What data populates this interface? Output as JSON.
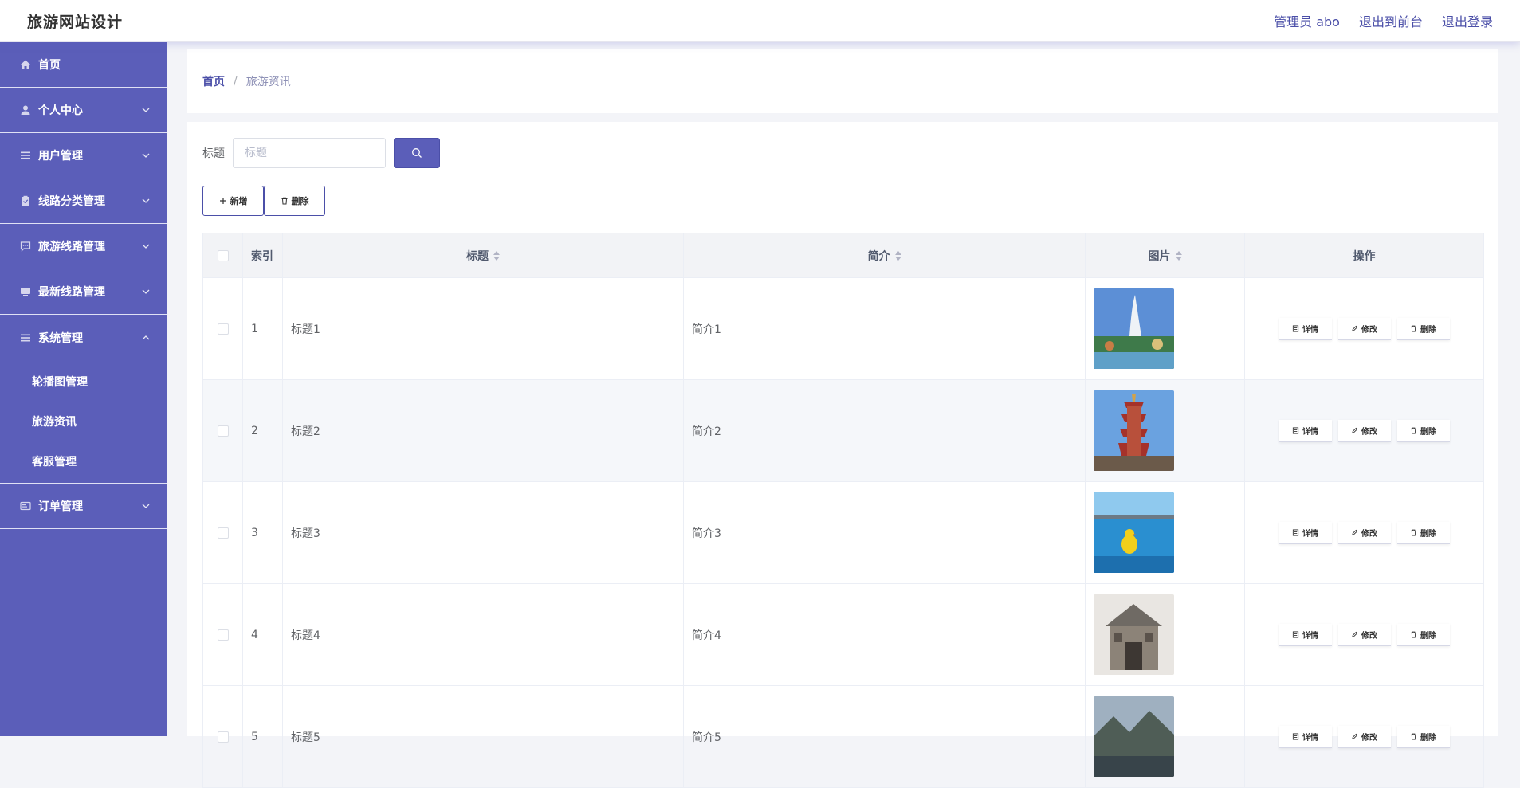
{
  "header": {
    "title": "旅游网站设计",
    "admin_label": "管理员 abo",
    "front_link": "退出到前台",
    "logout_link": "退出登录"
  },
  "sidebar": {
    "items": [
      {
        "label": "首页",
        "icon": "home-icon"
      },
      {
        "label": "个人中心",
        "icon": "user-icon"
      },
      {
        "label": "用户管理",
        "icon": "list-icon"
      },
      {
        "label": "线路分类管理",
        "icon": "clipboard-icon"
      },
      {
        "label": "旅游线路管理",
        "icon": "chat-icon"
      },
      {
        "label": "最新线路管理",
        "icon": "monitor-icon"
      },
      {
        "label": "系统管理",
        "icon": "list-icon"
      },
      {
        "label": "订单管理",
        "icon": "card-icon"
      }
    ],
    "system_sub": [
      "轮播图管理",
      "旅游资讯",
      "客服管理"
    ]
  },
  "breadcrumb": {
    "home": "首页",
    "sep": "/",
    "current": "旅游资讯"
  },
  "search": {
    "label": "标题",
    "placeholder": "标题"
  },
  "actions": {
    "add": "新增",
    "delete": "删除"
  },
  "table": {
    "headers": {
      "index": "索引",
      "title": "标题",
      "intro": "简介",
      "image": "图片",
      "ops": "操作"
    },
    "ops": {
      "detail": "详情",
      "edit": "修改",
      "delete": "删除"
    },
    "rows": [
      {
        "index": "1",
        "title": "标题1",
        "intro": "简介1"
      },
      {
        "index": "2",
        "title": "标题2",
        "intro": "简介2"
      },
      {
        "index": "3",
        "title": "标题3",
        "intro": "简介3"
      },
      {
        "index": "4",
        "title": "标题4",
        "intro": "简介4"
      },
      {
        "index": "5",
        "title": "标题5",
        "intro": "简介5"
      }
    ]
  },
  "colors": {
    "accent": "#5b5eb9",
    "accent_dark": "#4b4fa8"
  }
}
